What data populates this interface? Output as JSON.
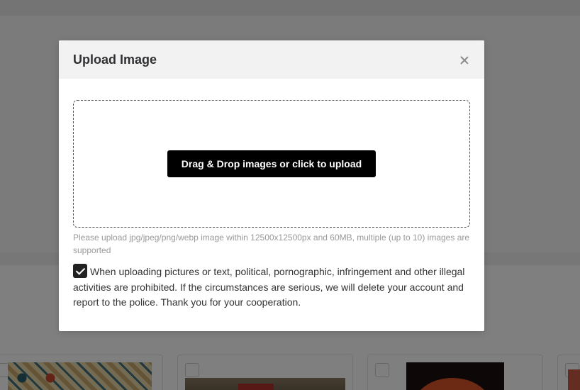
{
  "modal": {
    "title": "Upload Image",
    "close_icon": "close-icon",
    "upload_button_label": "Drag & Drop images or click to upload",
    "hint": "Please upload jpg/jpeg/png/webp image within 12500x12500px and 60MB, multiple (up to 10) images are supported",
    "agreement_checked": true,
    "agreement_text": "When uploading pictures or text, political, pornographic, infringement and other illegal activities are prohibited. If the circumstances are serious, we will delete your account and report to the police. Thank you for your cooperation."
  },
  "colors": {
    "overlay": "#808080",
    "header_bg": "#f2f2f2",
    "button_bg": "#000000",
    "hint_text": "#999999"
  }
}
